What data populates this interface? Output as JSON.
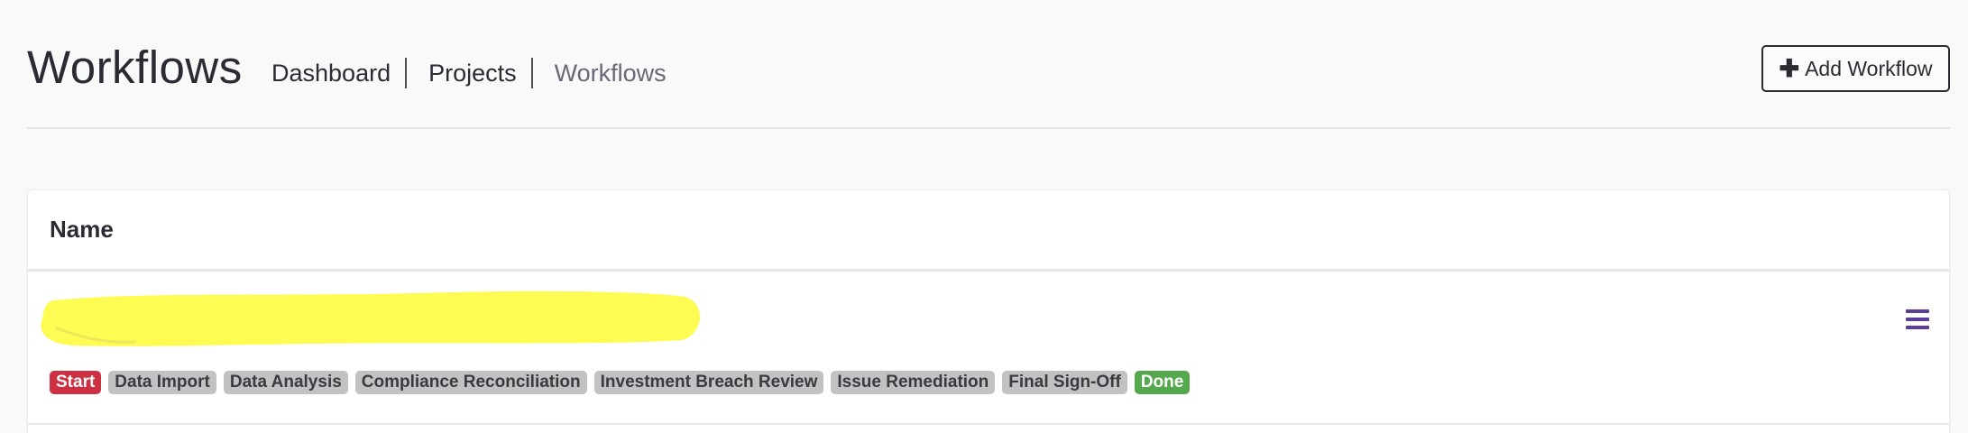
{
  "header": {
    "title": "Workflows",
    "breadcrumb": [
      {
        "label": "Dashboard"
      },
      {
        "label": "Projects"
      },
      {
        "label": "Workflows"
      }
    ],
    "add_button": {
      "icon": "plus-icon",
      "label": "Add Workflow"
    }
  },
  "table": {
    "columns": [
      "Name"
    ],
    "rows": [
      {
        "name": "",
        "redacted": true,
        "menu_icon": "hamburger-menu-icon",
        "stages": [
          {
            "label": "Start",
            "status": "start",
            "color": "#cd2f43"
          },
          {
            "label": "Data Import",
            "status": "neutral",
            "color": "#c2c2c4"
          },
          {
            "label": "Data Analysis",
            "status": "neutral",
            "color": "#c2c2c4"
          },
          {
            "label": "Compliance Reconciliation",
            "status": "neutral",
            "color": "#c2c2c4"
          },
          {
            "label": "Investment Breach Review",
            "status": "neutral",
            "color": "#c2c2c4"
          },
          {
            "label": "Issue Remediation",
            "status": "neutral",
            "color": "#c2c2c4"
          },
          {
            "label": "Final Sign-Off",
            "status": "neutral",
            "color": "#c2c2c4"
          },
          {
            "label": "Done",
            "status": "done",
            "color": "#56a84e"
          }
        ]
      }
    ]
  },
  "colors": {
    "accent": "#5c3d99",
    "redaction": "#fefb52"
  }
}
